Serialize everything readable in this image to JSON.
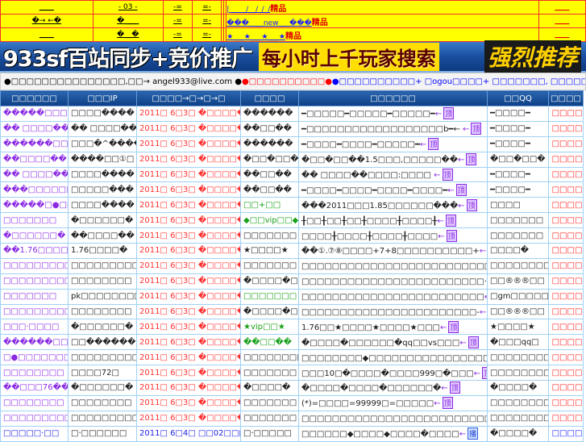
{
  "top_links": [
    [
      "____",
      "- 03 -",
      "-=",
      "=-",
      "",
      "",
      "| ____/__/_/_/",
      "____"
    ],
    [
      "�→ ←�",
      "�____",
      "-=",
      "=-",
      "",
      "",
      "���____new___���",
      "____"
    ],
    [
      "____",
      "�__�",
      "-=",
      "=-",
      "",
      "",
      "★___★___★___★",
      "____"
    ]
  ],
  "top_tag": "精品",
  "banner": {
    "part1": "933sf百站同步+竞价推广",
    "part2": "每小时上千玩家搜索",
    "part3": "强烈推荐"
  },
  "info": {
    "text1": "●□□□□□□□□□□□□□□□,□□→ angel933@live.com ●",
    "text2": "●□□□□□□□□□□●",
    "text3": "●□□□□□□□□□□+ □ogou□□□□+ □□□□□□□, □□□□□□□●"
  },
  "headers": [
    "□□□□□□",
    "□□□IP",
    "□□□□→□→□→□",
    "□□□□",
    "□□□□□□",
    "□□QQ",
    "□□□□"
  ],
  "badge_top": "顶",
  "badge_broadcast": "播",
  "rows": [
    {
      "name": "�����□□□□",
      "ip": "□□□□����",
      "time": "2011□ 6□3□ �□□□□�",
      "ver": "������",
      "intro": "━□□□□□━□□□□□━□□□□□━",
      "qq": "━□□□□━",
      "act": "□□□□"
    },
    {
      "name": "�� □□□□��",
      "ip": "�� □□□□��",
      "time": "2011□ 6□3□ �□□□□�",
      "ver": "��□□��",
      "intro": "━□□□□□□□□□□□□□□□□□□b━← ",
      "qq": "━□□□□━",
      "act": "□□□□"
    },
    {
      "name": "������□□□",
      "ip": "□□□�^����",
      "time": "2011□ 6□3□ �□□□□�",
      "ver": "������",
      "intro": "━□□□□━□□□□━□□□□□━",
      "qq": "━□□□□━",
      "act": "□□□□"
    },
    {
      "name": "��□□□□��",
      "ip": "����□□①□",
      "time": "2011□ 6□3□ �□□□□�",
      "ver": "�□□�□□�",
      "intro": "�□□�□□��1.5□□□,□□□□□��",
      "qq": "�□□�□□�",
      "act": "□□□□"
    },
    {
      "name": "�� □□□□��",
      "ip": "□□□□����",
      "time": "2011□ 6□3□ �□□□□�",
      "ver": "��□□��",
      "intro": "�� □□□□��□□□□:□□□□ ",
      "qq": "━□□□□━",
      "act": "□□□□"
    },
    {
      "name": "���□□□□□□",
      "ip": "□□□□□���",
      "time": "2011□ 6□3□ �□□□□�",
      "ver": "��□□��",
      "intro": "━□□□□━□□□□━□□□□━□□□□━",
      "qq": "━□□□□━",
      "act": "□□□□"
    },
    {
      "name": "�����□●□□",
      "ip": "□□□□����",
      "time": "2011□ 6□3□ �□□□□�",
      "ver": "□□+□□",
      "ver_green": true,
      "intro": "���2011□□□1.85□□□□□□���",
      "qq": "□□□□",
      "act": "□□□□"
    },
    {
      "name": "□□□□□□□",
      "ip": "�□□□□□□�",
      "time": "2011□ 6□3□ �□□□□�",
      "ver": "◆□□vip□□◆",
      "ver_green": true,
      "intro": "╂□□╂□□╂□□╂□□□□╂□□□□╂",
      "qq": "□□□□□□□",
      "act": "□□□□"
    },
    {
      "name": "�□□□□□□�",
      "ip": "��□□□□��",
      "time": "2011□ 6□3□ �□□□□�",
      "ver": "□□□□□□□",
      "intro": "□□□□╂□□□□╂□□□□╂□□□□",
      "qq": "□□□□□□□",
      "act": "□□□□"
    },
    {
      "name": "��1.76□□□□��",
      "ip": "1.76□□□□�",
      "time": "2011□ 6□3□ �□□□□�",
      "ver": "★□□□□★",
      "intro": "��①.⑦⑧□□□□+7+8□□□□□□□□□□+",
      "qq": "□□□□�",
      "act": "□□□□"
    },
    {
      "name": "□□□□□□□□□□",
      "ip": "□□□□□□□□□",
      "time": "2011□ 6□3□ �□□□□�",
      "ver": "□□□□□□□",
      "intro": "□□□□□□□□□□□□□□□□□□□□□□□□□",
      "qq": "□□□□□□□□□",
      "act": "□□□□"
    },
    {
      "name": "□□□□□□□□□□□",
      "ip": "□□□□□□□□",
      "time": "2011□ 6□3□ �□□□□�",
      "ver": "�□□□□�□□□□□□",
      "intro": "□□□□□□□□□□□□□□□□□□□□□□□□· ",
      "qq": "□□®®®□□",
      "act": "□□□□"
    },
    {
      "name": "□□□□□□□",
      "ip": "pk□□□□□□□□",
      "time": "2011□ 6□3□ �□□□□�",
      "ver": "□□□□□□□",
      "ver_green": true,
      "intro": "□□□□□□□□□□□□□□□□□□□□□□□□",
      "qq": "□gm□□□□□",
      "act": "□□□□"
    },
    {
      "name": "□□□□□□□□□□□",
      "ip": "□□□□□□□□",
      "time": "2011□ 6□3□ �□□□□�",
      "ver": "�□□□□�□□□□□□",
      "intro": "□□□□□□□□□□□□□□□□□□□□□□□-",
      "qq": "□□®®®□□",
      "act": "□□□□"
    },
    {
      "name": "□□□·□□□□",
      "ip": "�□□□□□□�",
      "time": "2011□ 6□3□ �□□□□�",
      "ver": "★vip□□★",
      "ver_green": true,
      "intro": "1.76□□★□□□□★□□□□★□□□",
      "qq": "★□□□□★",
      "act": "□□□□"
    },
    {
      "name": "������□□",
      "ip": "□□������",
      "time": "2011□ 6□3□ �□□□□�",
      "ver": "��□□��",
      "ver_green": true,
      "intro": "�□□□□�□□□□□□�qq□□vs□□□",
      "qq": "�□□□qq□",
      "act": "□□□□"
    },
    {
      "name": "□●□□□□□□□",
      "ip": "□□□□□□□□□",
      "time": "2011□ 6□3□ �□□□□�",
      "ver": "□□□□□□□□",
      "intro": "□□□□□□□□◆□□□□□□□□□□□□□□□□",
      "qq": "□□□□□□□□□",
      "act": "□□□□"
    },
    {
      "name": "□□□□□□□□",
      "ip": "□□□□72□",
      "time": "2011□ 6□3□ �□□□□�",
      "ver": "□□□□□□□",
      "intro": "□□□10□�□□□□�□□□□999□�□□□",
      "qq": "□□□□□□□□",
      "act": "□□□□"
    },
    {
      "name": "��□□□76��",
      "ip": "�□□□□□□�",
      "time": "2011□ 6□3□ �□□□□�",
      "ver": "�□□□□�",
      "intro": "�□□□□�□□□□�□□□□□□�",
      "qq": "�□□□□�",
      "act": "□□□□"
    },
    {
      "name": "□□□□□□□□",
      "ip": "□□□□□□□□",
      "time": "2011□ 6□3□ �□□□□�",
      "ver": "□□□□□□□",
      "intro": "(*)=□□□□=99999□=□□□□□",
      "qq": "□□□□□□□□",
      "act": "□□□□"
    },
    {
      "name": "□□□□□□□□□",
      "ip": "□□□□□□□□□",
      "time": "2011□ 6□3□ �□□□□�",
      "ver": "□□□□□□□",
      "intro": "□□□□□□□□□□□□□□□□□□□□□□□□□□",
      "qq": "□□□□□□□□",
      "act": "□□□□"
    },
    {
      "name": "□□□□□·□□",
      "ip": "□·□□□□□□",
      "time": "2011□ 6□4□ □□02□□□",
      "ver": "□·□□□□□",
      "intro": "□□□□□□◆□□□□◆□□□□�□□□□",
      "qq": "�□□□□�",
      "act": "□□□□",
      "blue": true
    }
  ]
}
